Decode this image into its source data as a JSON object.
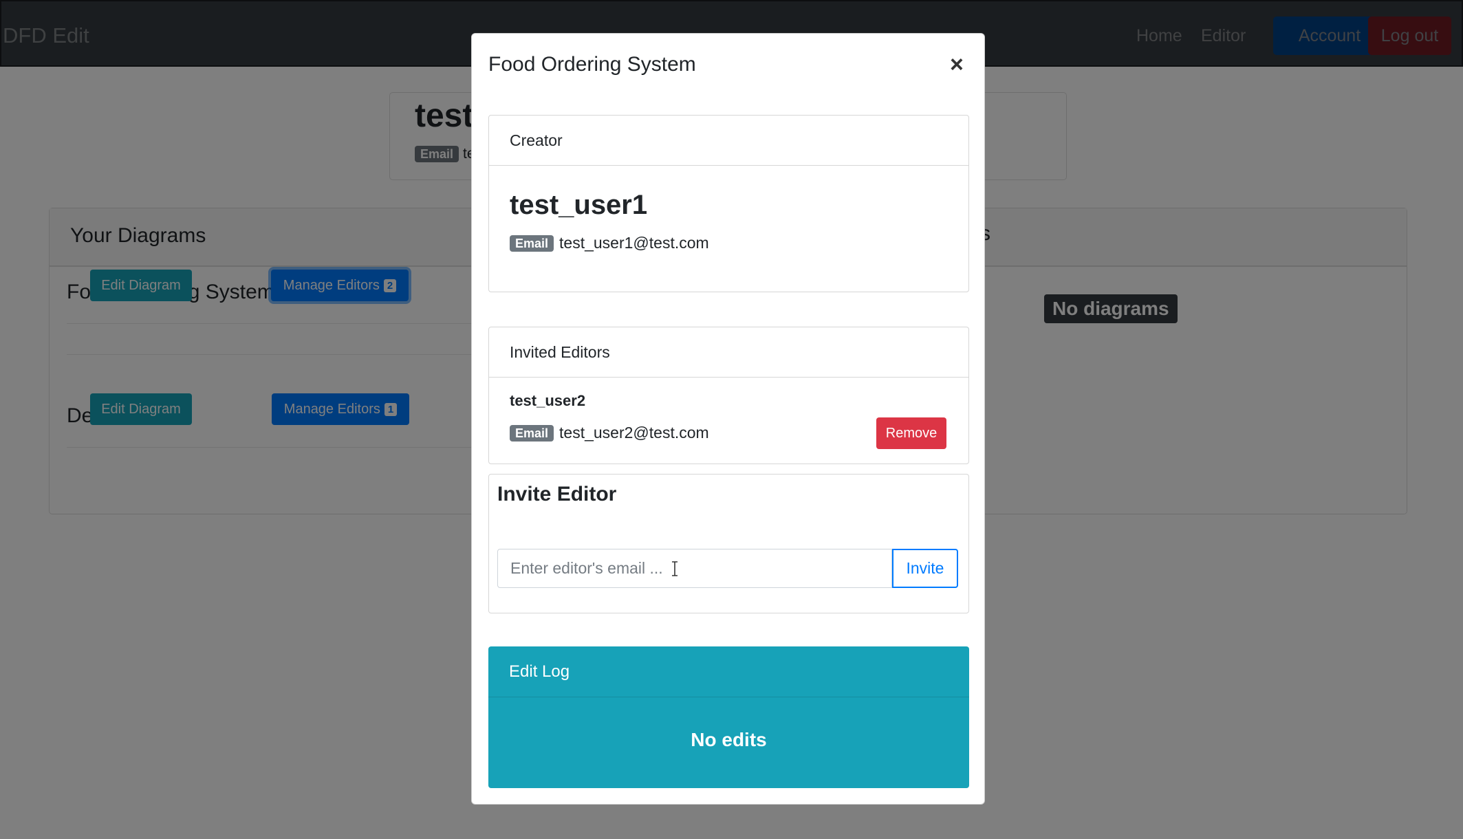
{
  "navbar": {
    "brand": "DFD Edit",
    "links": [
      "Home",
      "Editor"
    ],
    "account_label": "Account",
    "logout_label": "Log out"
  },
  "profile": {
    "name": "test_",
    "email_badge": "Email",
    "email": "te"
  },
  "diagrams": {
    "title": "Your Diagrams",
    "items": [
      {
        "name": "Food Ordering System",
        "edit_label": "Edit Diagram",
        "manage_label": "Manage Editors",
        "editor_count": "2"
      },
      {
        "name": "Demo DFD",
        "edit_label": "Edit Diagram",
        "manage_label": "Manage Editors",
        "editor_count": "1"
      }
    ],
    "shared_title_fragment": "s",
    "shared_empty": "No diagrams"
  },
  "modal": {
    "title": "Food Ordering System",
    "close_symbol": "×",
    "creator": {
      "header": "Creator",
      "name": "test_user1",
      "email_badge": "Email",
      "email": "test_user1@test.com"
    },
    "invited": {
      "header": "Invited Editors",
      "editors": [
        {
          "name": "test_user2",
          "email_badge": "Email",
          "email": "test_user2@test.com",
          "remove_label": "Remove"
        }
      ]
    },
    "invite": {
      "title": "Invite Editor",
      "placeholder": "Enter editor's email ...",
      "value": "",
      "button_label": "Invite"
    },
    "edit_log": {
      "header": "Edit Log",
      "empty": "No edits"
    }
  },
  "colors": {
    "navbar_bg": "#343a40",
    "primary": "#007bff",
    "danger": "#dc3545",
    "info": "#17a2b8",
    "secondary": "#6c757d"
  }
}
